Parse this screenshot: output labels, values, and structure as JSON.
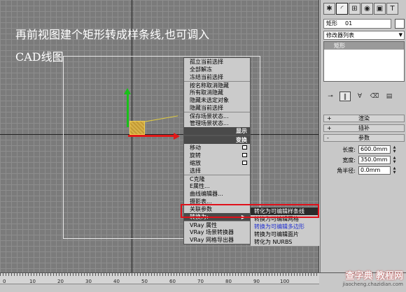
{
  "viewport": {
    "instruction_line1": "再前视图建个矩形转成样条线,也可调入",
    "instruction_line2": "CAD线图"
  },
  "quad_menu": {
    "top_items": [
      "孤立当前选择",
      "全部解冻",
      "冻结当前选择",
      "按名称取消隐藏",
      "所有取消隐藏",
      "隐藏未选定对象",
      "隐藏当前选择",
      "保存场景状态...",
      "管理场景状态..."
    ],
    "display_title": "显示",
    "transform_title": "变换",
    "transform_items": [
      "移动",
      "旋转",
      "缩放",
      "选择",
      "C克隆",
      "E属性...",
      "曲线编辑器...",
      "摄影表...",
      "关联参数",
      "转换为:",
      "VRay 属性",
      "VRay 场景转换器",
      "VRay 网格导出器"
    ],
    "convert_arrow": "▶"
  },
  "submenu": {
    "items": [
      "转化为可编辑样条线",
      "转换为可编辑网格",
      "转换为可编辑多边形",
      "转换为可编辑面片",
      "转化为 NURBS"
    ]
  },
  "timebar": {
    "ticks": [
      "0",
      "10",
      "20",
      "30",
      "40",
      "50",
      "60",
      "70",
      "80",
      "90",
      "100"
    ]
  },
  "watermark": {
    "main": "查字典 教程网",
    "url": "jiaocheng.chazidian.com"
  },
  "panel": {
    "object_name": "矩形",
    "object_id": "01",
    "modifier_list": "修改器列表",
    "stack_item": "矩形",
    "rollouts": {
      "render": "渲染",
      "interpolation": "插补",
      "parameters": "参数"
    },
    "params": [
      {
        "label": "长度:",
        "value": "600.0mm"
      },
      {
        "label": "宽度:",
        "value": "350.0mm"
      },
      {
        "label": "角半径:",
        "value": "0.0mm"
      }
    ]
  },
  "colors": {
    "highlight_red": "#e0101a",
    "gizmo_x": "#e01818",
    "gizmo_y": "#19c019",
    "menu_title_bg": "#4a4a4a"
  }
}
